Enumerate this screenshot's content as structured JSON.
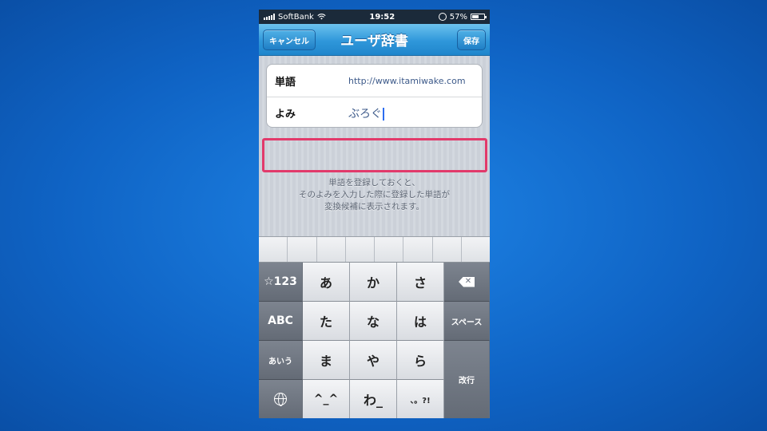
{
  "status_bar": {
    "carrier": "SoftBank",
    "time": "19:52",
    "battery": "57%",
    "battery_level": 0.57
  },
  "nav": {
    "cancel_label": "キャンセル",
    "title": "ユーザ辞書",
    "save_label": "保存"
  },
  "form": {
    "word_label": "単語",
    "word_value": "http://www.itamiwake.com",
    "reading_label": "よみ",
    "reading_value": "ぶろぐ"
  },
  "hint": {
    "line1": "単語を登録しておくと、",
    "line2": "そのよみを入力した際に登録した単語が",
    "line3": "変換候補に表示されます。"
  },
  "keyboard": {
    "symbols": "☆123",
    "a": "あ",
    "ka": "か",
    "sa": "さ",
    "abc": "ABC",
    "ta": "た",
    "na": "な",
    "ha": "は",
    "space": "スペース",
    "kana": "あいう",
    "ma": "ま",
    "ya": "や",
    "ra": "ら",
    "return": "改行",
    "emoticon": "^_^",
    "wa": "わ_",
    "punct": "、。?!"
  },
  "icons": {
    "signal": "signal-bars-icon",
    "wifi": "wifi-icon",
    "rotation_lock": "rotation-lock-icon",
    "battery": "battery-icon",
    "backspace": "backspace-icon",
    "globe": "globe-icon"
  },
  "colors": {
    "background": "#1474d8",
    "nav_bar": "#2f97da",
    "highlight": "#e23a6b",
    "caret": "#2d6df0"
  }
}
